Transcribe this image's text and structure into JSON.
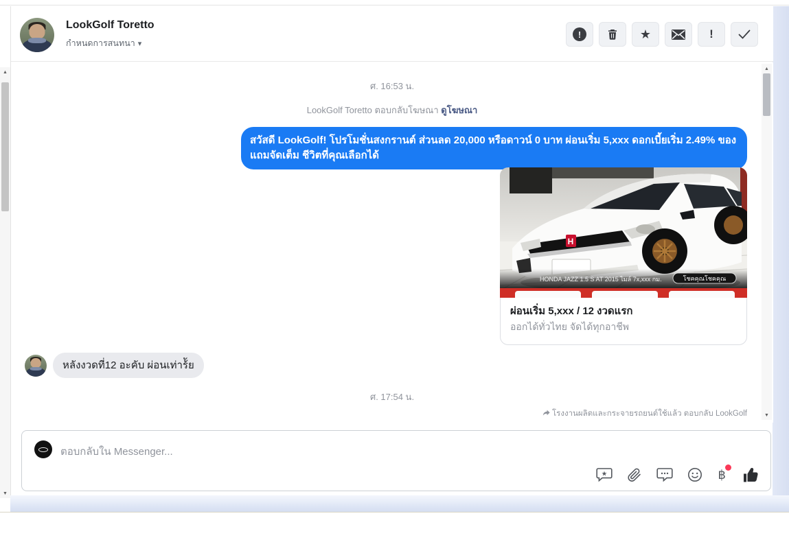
{
  "header": {
    "name": "LookGolf Toretto",
    "subtitle": "กำหนดการสนทนา",
    "toolbar_buttons": [
      "report-alert",
      "delete",
      "flag-follow-up",
      "mark-unread",
      "mark-spam",
      "mark-done"
    ]
  },
  "conversation": {
    "timestamp1": "ศ. 16:53 น.",
    "ad_meta": {
      "prefix": "LookGolf Toretto ตอบกลับโฆษณา",
      "link": "ดูโฆษณา"
    },
    "outgoing_message": "สวัสดี LookGolf! โปรโมชั่นสงกรานต์ ส่วนลด 20,000 หรือดาวน์ 0 บาท ผ่อนเริ่ม 5,xxx ดอกเบี้ยเริ่ม 2.49% ของแถมจัดเต็ม ชีวิตที่คุณเลือกได้",
    "attachment": {
      "image_caption_left": "HONDA JAZZ 1.5 S AT 2015 ไมล์ 7x,xxx กม.",
      "image_caption_right": "โชคคุณโชคคุณ",
      "title": "ผ่อนเริ่ม 5,xxx / 12 งวดแรก",
      "subtitle": "ออกได้ทั่วไทย จัดได้ทุกอาชีพ"
    },
    "incoming_message": "หลังงวดที่12 อะคับ ผ่อนเท่าร้ัย",
    "timestamp2": "ศ. 17:54 น.",
    "ad_context": "โรงงานผลิตและกระจายรถยนต์ใช้แล้ว ตอบกลับ LookGolf"
  },
  "composer": {
    "placeholder": "ตอบกลับใน Messenger..."
  },
  "icons": {
    "caret_down": "▾",
    "star": "★",
    "exclamation": "!",
    "check": "✓",
    "baht": "฿",
    "up_arrow": "▲",
    "down_arrow": "▼"
  },
  "colors": {
    "outgoing_bubble": "#1a7bf4",
    "incoming_bubble": "#e9eaee",
    "ad_link": "#4a5a85",
    "timestamp": "#90949c",
    "notification_dot": "#fb3958",
    "page_background_strip": "#dde5f5"
  }
}
